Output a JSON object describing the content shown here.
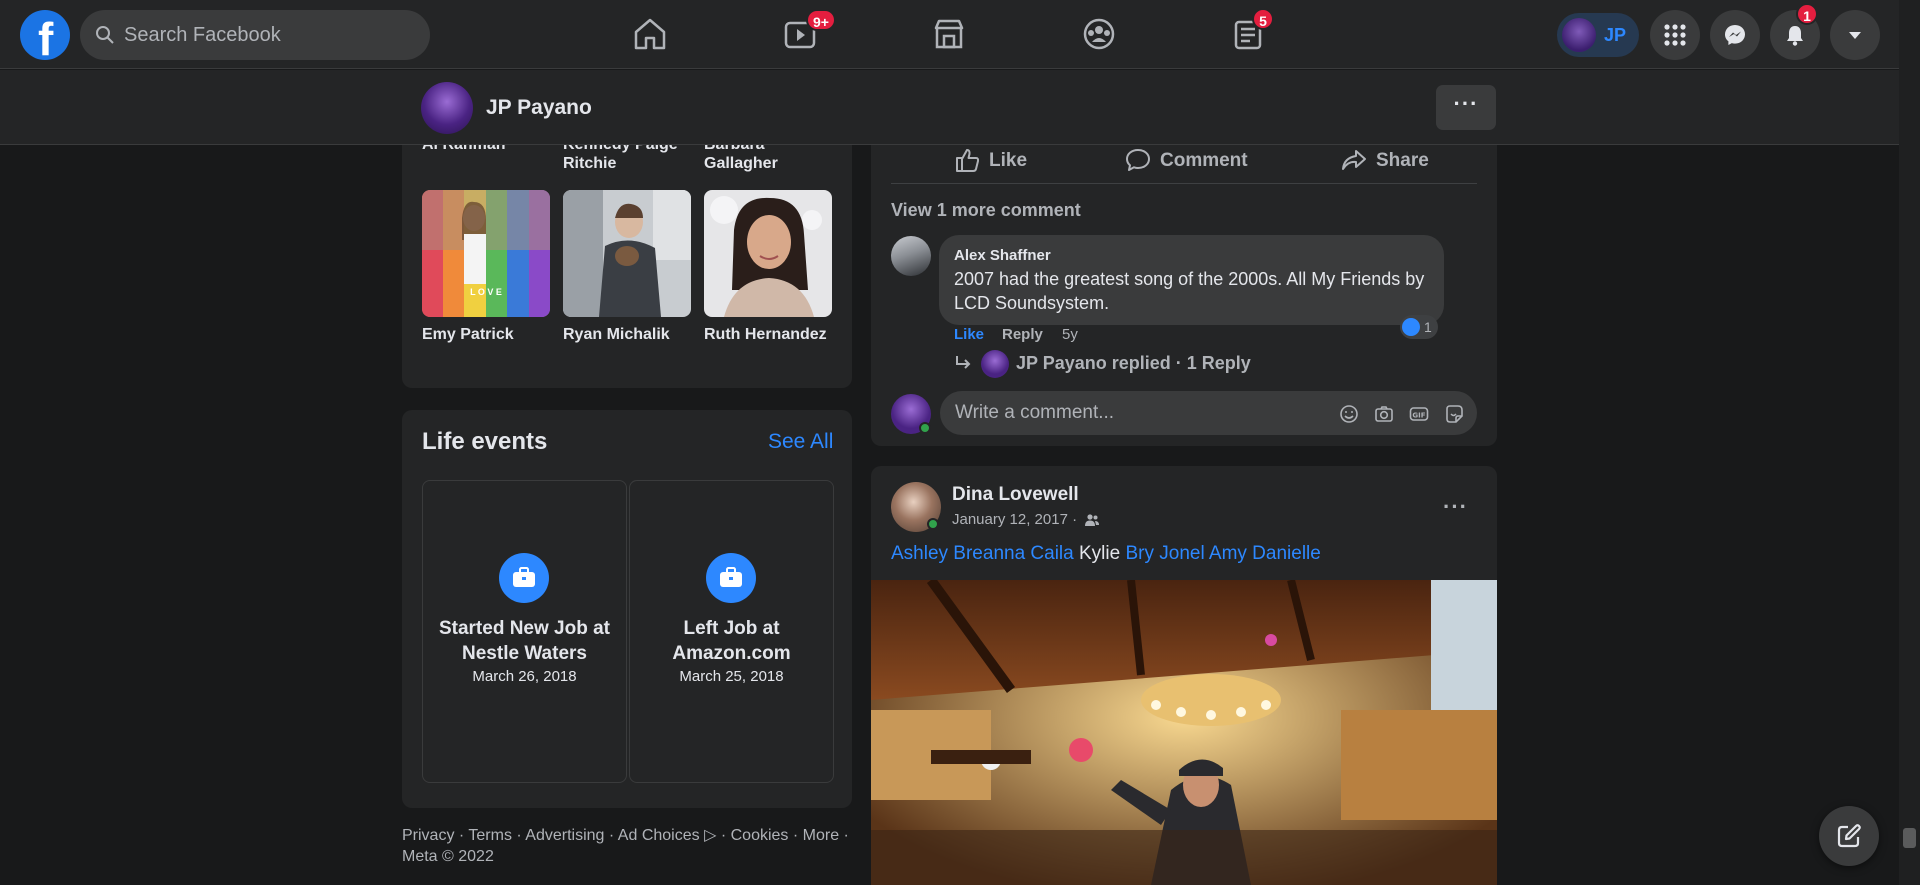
{
  "topbar": {
    "search_placeholder": "Search Facebook",
    "watch_badge": "9+",
    "news_badge": "5",
    "profile_initials": "JP",
    "notifications_badge": "1",
    "accent_color": "#2d88ff",
    "badge_color": "#e41e3f"
  },
  "profile_bar": {
    "name": "JP Payano",
    "more_label": "···"
  },
  "friends": {
    "cut_names": [
      "Al Rahman",
      "Kennedy Paige Ritchie",
      "Barbara Gallagher"
    ],
    "photos": [
      {
        "name": "Emy Patrick",
        "overlay": "L O V E"
      },
      {
        "name": "Ryan Michalik"
      },
      {
        "name": "Ruth Hernandez"
      }
    ]
  },
  "life_events": {
    "title": "Life events",
    "see_all": "See All",
    "items": [
      {
        "title": "Started New Job at Nestle Waters",
        "date": "March 26, 2018"
      },
      {
        "title": "Left Job at Amazon.com",
        "date": "March 25, 2018"
      }
    ]
  },
  "footer": {
    "links": [
      "Privacy",
      "Terms",
      "Advertising",
      "Ad Choices",
      "Cookies",
      "More"
    ],
    "copyright": "Meta © 2022"
  },
  "post1": {
    "actions": {
      "like": "Like",
      "comment": "Comment",
      "share": "Share"
    },
    "view_more": "View 1 more comment",
    "comment": {
      "author": "Alex Shaffner",
      "text": "2007 had the greatest song of the 2000s. All My Friends by LCD Soundsystem.",
      "like": "Like",
      "reply": "Reply",
      "age": "5y",
      "reaction_count": "1"
    },
    "reply_summary": "JP Payano replied · 1 Reply",
    "write_placeholder": "Write a comment..."
  },
  "post2": {
    "author": "Dina Lovewell",
    "date": "January 12, 2017 ·",
    "tags": [
      {
        "text": "Ashley Breanna Caila",
        "link": true
      },
      {
        "text": "Kylie",
        "link": false
      },
      {
        "text": "Bry Jonel Amy Danielle",
        "link": true
      }
    ],
    "more_label": "···"
  }
}
